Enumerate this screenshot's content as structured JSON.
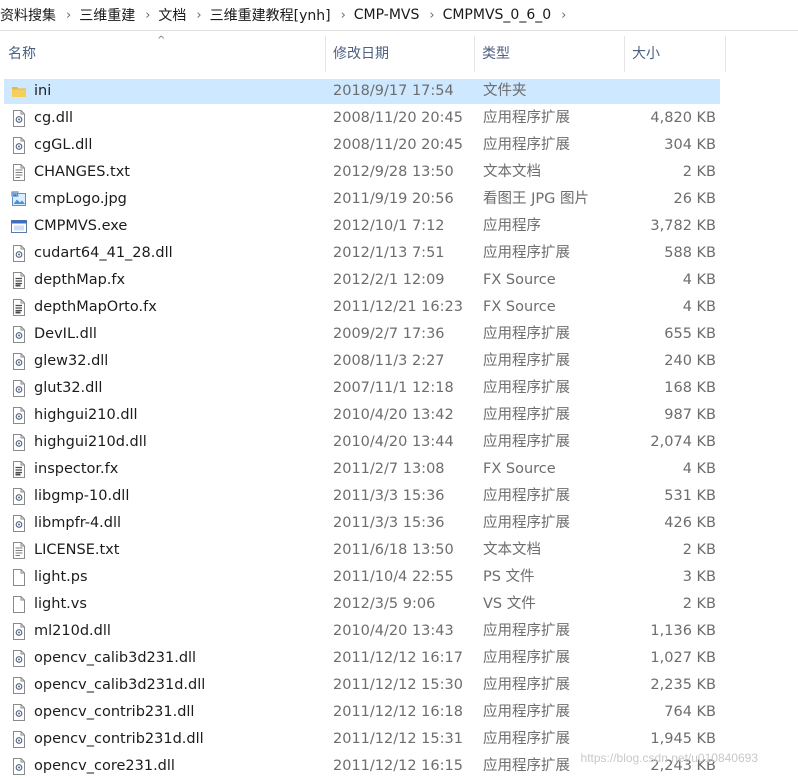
{
  "breadcrumb": [
    "资料搜集",
    "三维重建",
    "文档",
    "三维重建教程[ynh]",
    "CMP-MVS",
    "CMPMVS_0_6_0"
  ],
  "columns": {
    "name": "名称",
    "date": "修改日期",
    "type": "类型",
    "size": "大小"
  },
  "files": [
    {
      "name": "ini",
      "date": "2018/9/17 17:54",
      "type": "文件夹",
      "size": "",
      "icon": "folder-icon"
    },
    {
      "name": "cg.dll",
      "date": "2008/11/20 20:45",
      "type": "应用程序扩展",
      "size": "4,820 KB",
      "icon": "dll-icon"
    },
    {
      "name": "cgGL.dll",
      "date": "2008/11/20 20:45",
      "type": "应用程序扩展",
      "size": "304 KB",
      "icon": "dll-icon"
    },
    {
      "name": "CHANGES.txt",
      "date": "2012/9/28 13:50",
      "type": "文本文档",
      "size": "2 KB",
      "icon": "text-file-icon"
    },
    {
      "name": "cmpLogo.jpg",
      "date": "2011/9/19 20:56",
      "type": "看图王 JPG 图片",
      "size": "26 KB",
      "icon": "image-file-icon"
    },
    {
      "name": "CMPMVS.exe",
      "date": "2012/10/1 7:12",
      "type": "应用程序",
      "size": "3,782 KB",
      "icon": "exe-icon"
    },
    {
      "name": "cudart64_41_28.dll",
      "date": "2012/1/13 7:51",
      "type": "应用程序扩展",
      "size": "588 KB",
      "icon": "dll-icon"
    },
    {
      "name": "depthMap.fx",
      "date": "2012/2/1 12:09",
      "type": "FX Source",
      "size": "4 KB",
      "icon": "source-file-icon"
    },
    {
      "name": "depthMapOrto.fx",
      "date": "2011/12/21 16:23",
      "type": "FX Source",
      "size": "4 KB",
      "icon": "source-file-icon"
    },
    {
      "name": "DevIL.dll",
      "date": "2009/2/7 17:36",
      "type": "应用程序扩展",
      "size": "655 KB",
      "icon": "dll-icon"
    },
    {
      "name": "glew32.dll",
      "date": "2008/11/3 2:27",
      "type": "应用程序扩展",
      "size": "240 KB",
      "icon": "dll-icon"
    },
    {
      "name": "glut32.dll",
      "date": "2007/11/1 12:18",
      "type": "应用程序扩展",
      "size": "168 KB",
      "icon": "dll-icon"
    },
    {
      "name": "highgui210.dll",
      "date": "2010/4/20 13:42",
      "type": "应用程序扩展",
      "size": "987 KB",
      "icon": "dll-icon"
    },
    {
      "name": "highgui210d.dll",
      "date": "2010/4/20 13:44",
      "type": "应用程序扩展",
      "size": "2,074 KB",
      "icon": "dll-icon"
    },
    {
      "name": "inspector.fx",
      "date": "2011/2/7 13:08",
      "type": "FX Source",
      "size": "4 KB",
      "icon": "source-file-icon"
    },
    {
      "name": "libgmp-10.dll",
      "date": "2011/3/3 15:36",
      "type": "应用程序扩展",
      "size": "531 KB",
      "icon": "dll-icon"
    },
    {
      "name": "libmpfr-4.dll",
      "date": "2011/3/3 15:36",
      "type": "应用程序扩展",
      "size": "426 KB",
      "icon": "dll-icon"
    },
    {
      "name": "LICENSE.txt",
      "date": "2011/6/18 13:50",
      "type": "文本文档",
      "size": "2 KB",
      "icon": "text-file-icon"
    },
    {
      "name": "light.ps",
      "date": "2011/10/4 22:55",
      "type": "PS 文件",
      "size": "3 KB",
      "icon": "blank-file-icon"
    },
    {
      "name": "light.vs",
      "date": "2012/3/5 9:06",
      "type": "VS 文件",
      "size": "2 KB",
      "icon": "blank-file-icon"
    },
    {
      "name": "ml210d.dll",
      "date": "2010/4/20 13:43",
      "type": "应用程序扩展",
      "size": "1,136 KB",
      "icon": "dll-icon"
    },
    {
      "name": "opencv_calib3d231.dll",
      "date": "2011/12/12 16:17",
      "type": "应用程序扩展",
      "size": "1,027 KB",
      "icon": "dll-icon"
    },
    {
      "name": "opencv_calib3d231d.dll",
      "date": "2011/12/12 15:30",
      "type": "应用程序扩展",
      "size": "2,235 KB",
      "icon": "dll-icon"
    },
    {
      "name": "opencv_contrib231.dll",
      "date": "2011/12/12 16:18",
      "type": "应用程序扩展",
      "size": "764 KB",
      "icon": "dll-icon"
    },
    {
      "name": "opencv_contrib231d.dll",
      "date": "2011/12/12 15:31",
      "type": "应用程序扩展",
      "size": "1,945 KB",
      "icon": "dll-icon"
    },
    {
      "name": "opencv_core231.dll",
      "date": "2011/12/12 16:15",
      "type": "应用程序扩展",
      "size": "2,243 KB",
      "icon": "dll-icon"
    }
  ],
  "selected_index": 0,
  "watermark": "https://blog.csdn.net/u010840693",
  "colors": {
    "selection": "#cde8ff",
    "header_text": "#4d6082"
  }
}
